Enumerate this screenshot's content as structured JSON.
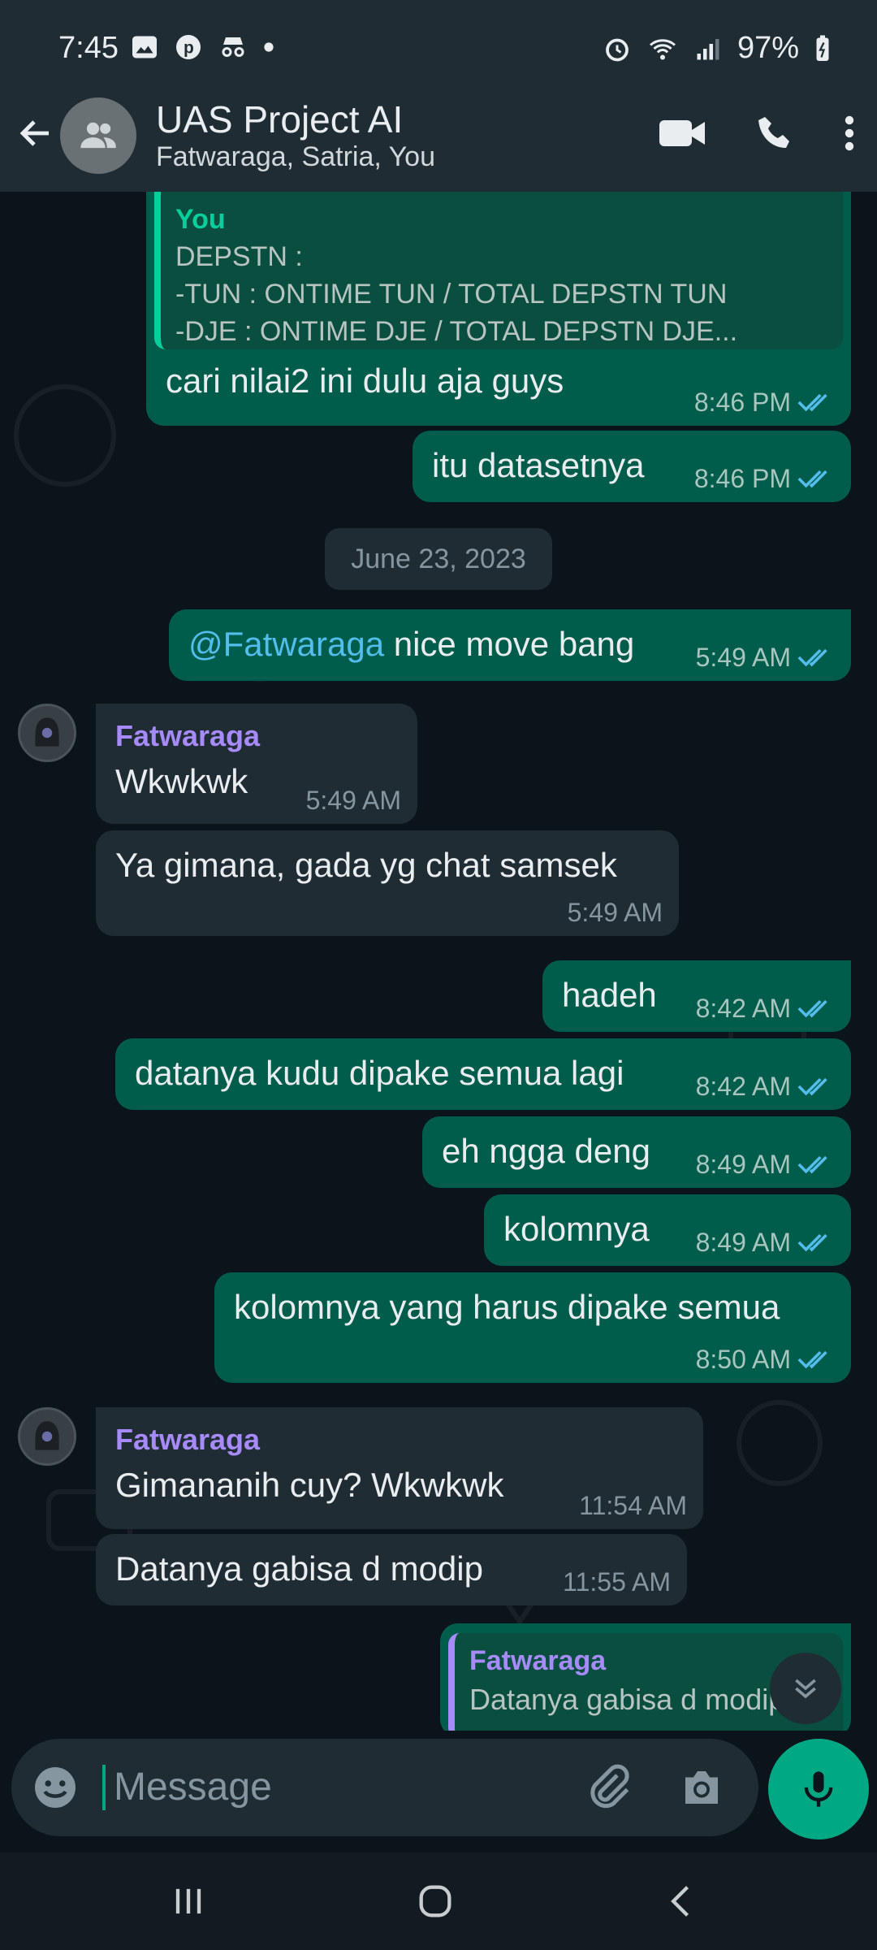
{
  "status_bar": {
    "time": "7:45",
    "battery": "97%"
  },
  "header": {
    "title": "UAS Project AI",
    "subtitle": "Fatwaraga, Satria, You"
  },
  "messages": {
    "m1": {
      "quote_name": "You",
      "quote_lines": [
        "DEPSTN :",
        "-TUN : ONTIME TUN / TOTAL DEPSTN TUN",
        "-DJE : ONTIME DJE / TOTAL DEPSTN DJE..."
      ],
      "text": "cari nilai2 ini dulu aja guys",
      "time": "8:46 PM"
    },
    "m2": {
      "text": "itu datasetnya",
      "time": "8:46 PM"
    },
    "date_divider": "June 23, 2023",
    "m3": {
      "mention": "@Fatwaraga",
      "text": " nice move bang",
      "time": "5:49 AM"
    },
    "m4": {
      "sender": "Fatwaraga",
      "text": "Wkwkwk",
      "time": "5:49 AM"
    },
    "m5": {
      "text": "Ya gimana, gada yg chat samsek",
      "time": "5:49 AM"
    },
    "m6": {
      "text": "hadeh",
      "time": "8:42 AM"
    },
    "m7": {
      "text": "datanya kudu dipake semua lagi",
      "time": "8:42 AM"
    },
    "m8": {
      "text": "eh ngga deng",
      "time": "8:49 AM"
    },
    "m9": {
      "text": "kolomnya",
      "time": "8:49 AM"
    },
    "m10": {
      "text": "kolomnya yang harus dipake semua",
      "time": "8:50 AM"
    },
    "m11": {
      "sender": "Fatwaraga",
      "text": "Gimananih cuy? Wkwkwk",
      "time": "11:54 AM"
    },
    "m12": {
      "text": "Datanya gabisa d modip",
      "time": "11:55 AM"
    },
    "m13": {
      "quote_name": "Fatwaraga",
      "quote_text": "Datanya gabisa d modip"
    }
  },
  "composer": {
    "placeholder": "Message"
  },
  "colors": {
    "outgoing_bubble": "#005c4b",
    "incoming_bubble": "#202c33",
    "accent": "#00a884",
    "sender_name": "#a78bfa",
    "read_tick": "#53bdeb"
  }
}
